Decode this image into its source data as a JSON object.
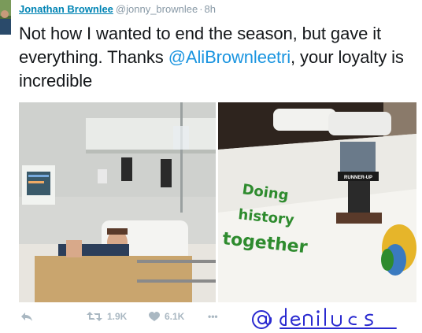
{
  "tweet": {
    "author_name": "Jonathan Brownlee",
    "handle": "@jonny_brownlee",
    "separator": "·",
    "time": "8h",
    "text_part1": "Not how I wanted to end the season,  but gave it everything. Thanks ",
    "mention": "@AliBrownleetri",
    "text_part2": ",  your loyalty is incredible"
  },
  "photos": {
    "right_cake_text_line1": "Doing",
    "right_cake_text_line2": "history",
    "right_cake_text_line3": "together",
    "trophy_label": "RUNNER-UP"
  },
  "actions": {
    "retweet_count": "1.9K",
    "like_count": "6.1K",
    "more_label": "•••"
  },
  "watermark_text": "@denilucs",
  "colors": {
    "name": "#0084b4",
    "mention": "#1b95e0",
    "muted": "#8899a6",
    "action_icons": "#aab8c2",
    "watermark": "#2a2ad0"
  }
}
